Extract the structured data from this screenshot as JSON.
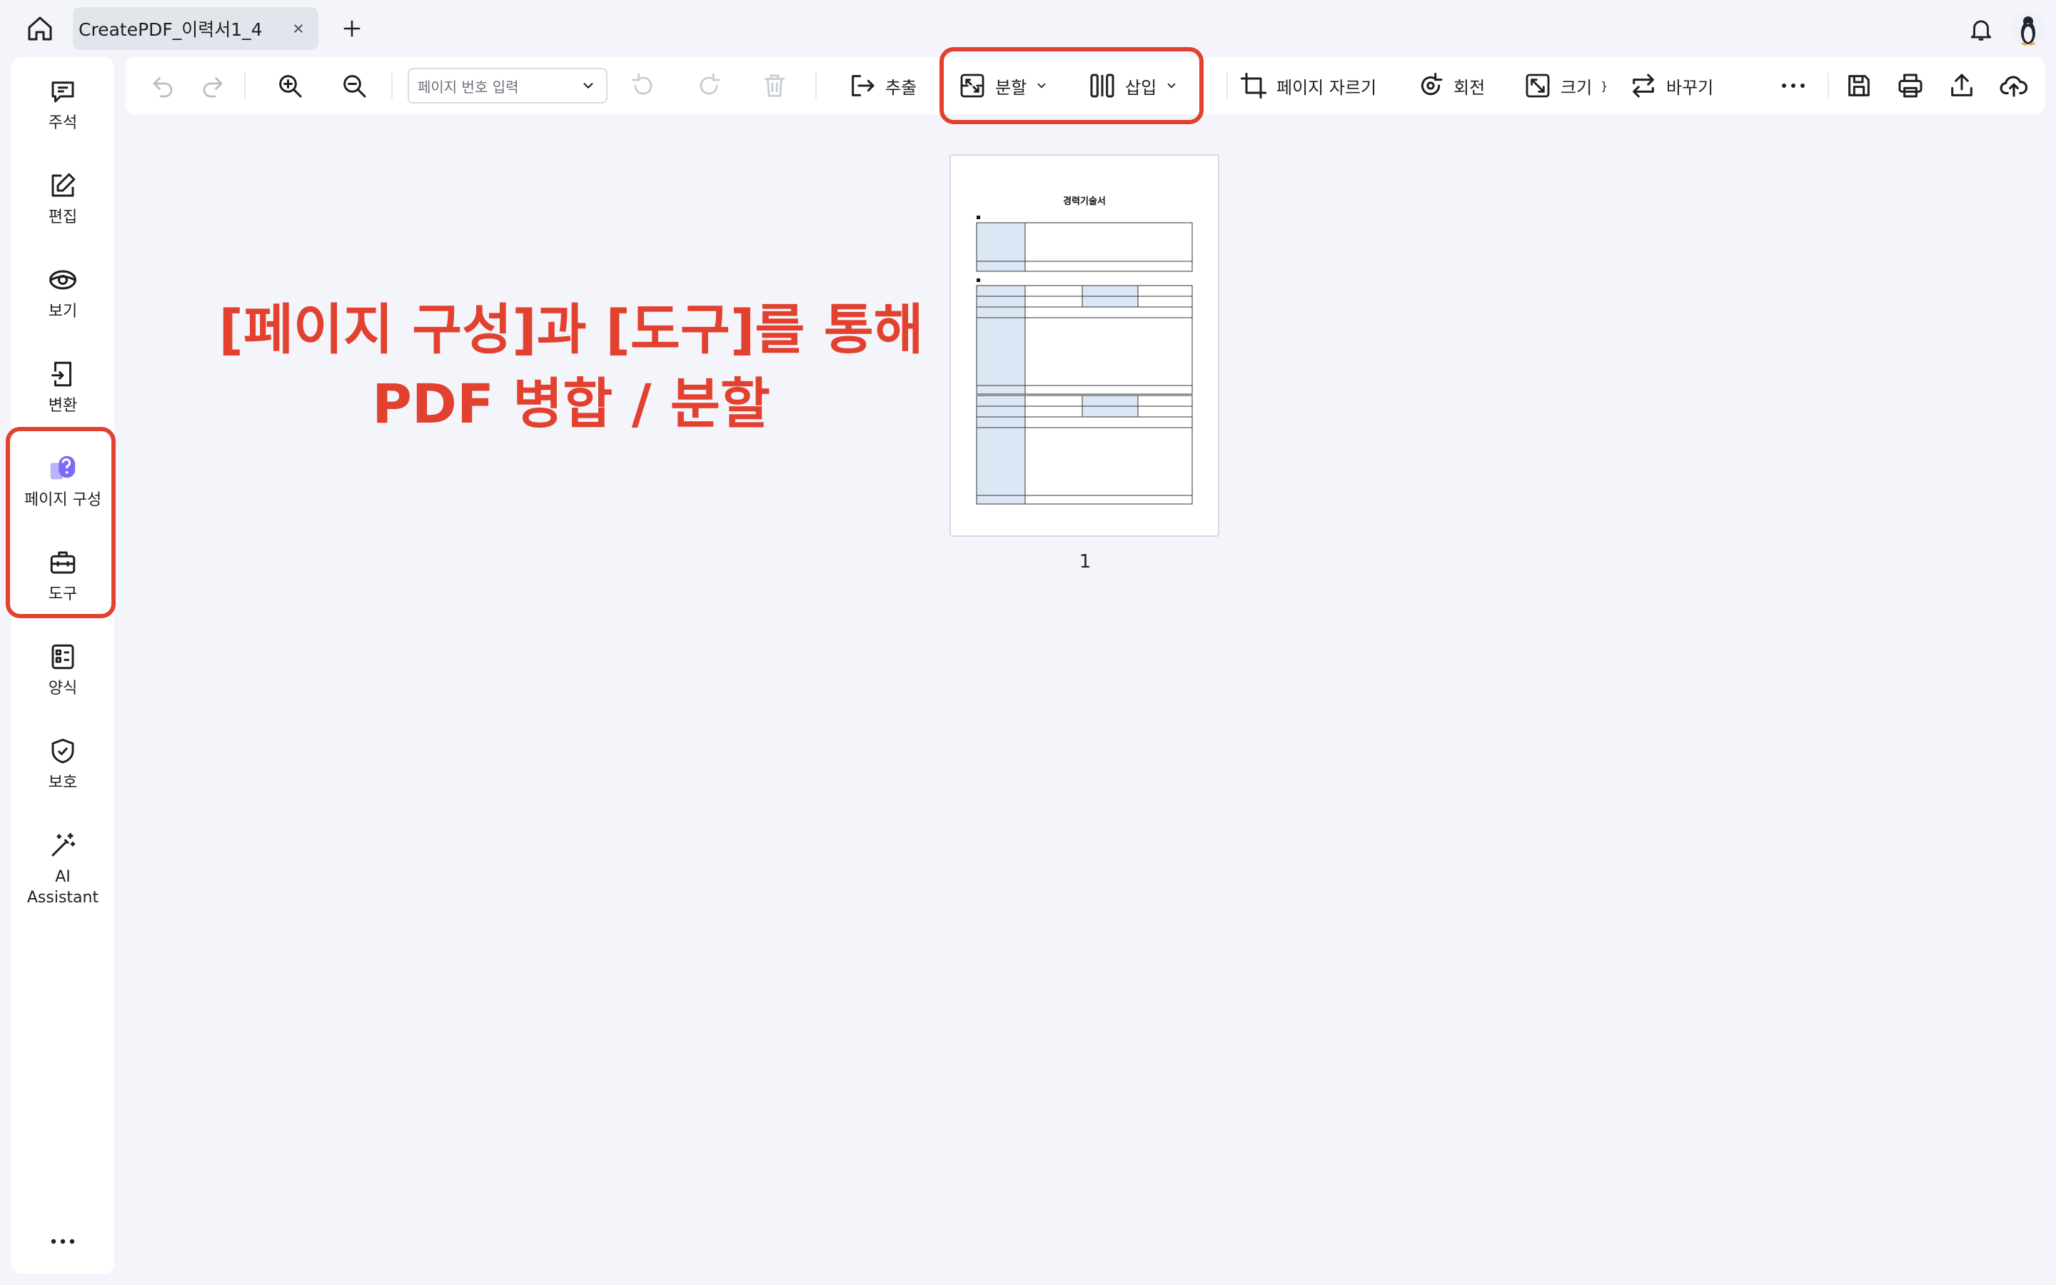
{
  "tab": {
    "title": "CreatePDF_이력서1_4"
  },
  "sidebar": {
    "items": [
      {
        "id": "annotate",
        "label": "주석",
        "icon": "comment-icon"
      },
      {
        "id": "edit",
        "label": "편집",
        "icon": "edit-icon"
      },
      {
        "id": "view",
        "label": "보기",
        "icon": "eye-icon"
      },
      {
        "id": "convert",
        "label": "변환",
        "icon": "convert-icon"
      },
      {
        "id": "organize",
        "label": "페이지 구성",
        "icon": "page-organize-icon"
      },
      {
        "id": "tools",
        "label": "도구",
        "icon": "toolbox-icon"
      },
      {
        "id": "forms",
        "label": "양식",
        "icon": "form-icon"
      },
      {
        "id": "protect",
        "label": "보호",
        "icon": "shield-check-icon"
      },
      {
        "id": "ai",
        "label": "AI Assistant",
        "label_line1": "AI",
        "label_line2": "Assistant",
        "icon": "magic-wand-icon"
      }
    ]
  },
  "toolbar": {
    "page_input_placeholder": "페이지 번호 입력",
    "extract": "추출",
    "split": "분할",
    "insert": "삽입",
    "crop": "페이지 자르기",
    "rotate": "회전",
    "size": "크기",
    "replace": "바꾸기"
  },
  "canvas": {
    "page_number": "1",
    "doc_title": "경력기술서"
  },
  "annotation": {
    "line1": "[페이지 구성]과 [도구]를 통해",
    "line2": "PDF 병합 / 분할"
  },
  "colors": {
    "highlight": "#e2412f",
    "background": "#f3f5fa",
    "accent_purple": "#7b6cf6"
  }
}
